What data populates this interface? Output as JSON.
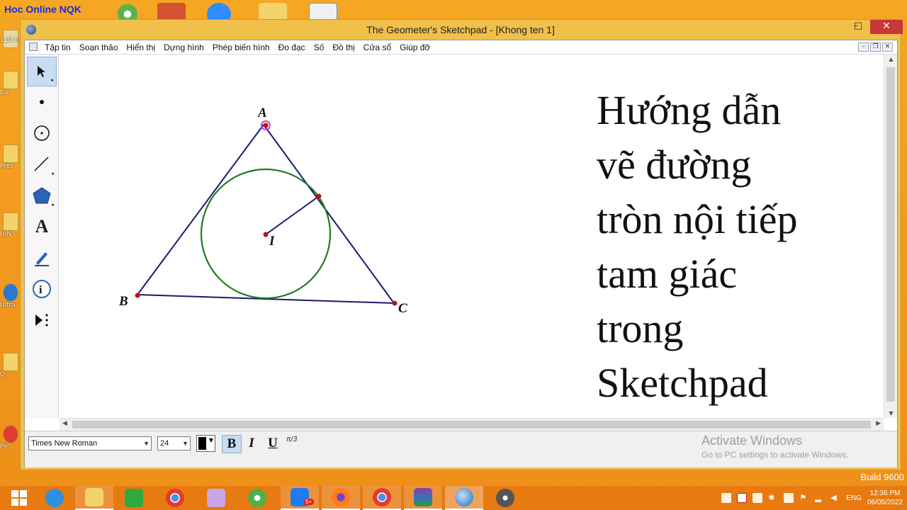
{
  "desktop": {
    "brand": "Hoc Online NQK",
    "top_icons": [
      "green-swirl-icon",
      "powerpoint-icon",
      "zoom-icon",
      "folder-icon",
      "document-icon"
    ],
    "left_items": [
      {
        "label": "110 b",
        "icon": "document-icon"
      },
      {
        "label": "ba",
        "icon": "folder-icon"
      },
      {
        "label": "Pres",
        "icon": "folder-icon"
      },
      {
        "label": "HIN",
        "icon": "folder-icon"
      },
      {
        "label": "Ultra",
        "icon": "shortcut-icon"
      },
      {
        "label": "Q",
        "icon": "folder-icon"
      },
      {
        "label": "Pe",
        "icon": "chrome-icon"
      }
    ],
    "activate_title": "Activate Windows",
    "activate_sub": "Go to PC settings to activate Windows.",
    "build": "Build 9600"
  },
  "window": {
    "title": "The Geometer's Sketchpad - [Khong ten 1]",
    "min": "–",
    "max": "□",
    "close": "✕"
  },
  "menu": {
    "items": [
      "Tập tin",
      "Soạn thảo",
      "Hiển thị",
      "Dựng hình",
      "Phép biến hình",
      "Đo đạc",
      "Số",
      "Đồ thị",
      "Cửa sổ",
      "Giúp đỡ"
    ],
    "mdi_min": "–",
    "mdi_restore": "❐",
    "mdi_close": "✕"
  },
  "tools": [
    {
      "name": "arrow-tool",
      "glyph": "➘",
      "active": true
    },
    {
      "name": "point-tool",
      "glyph": "•"
    },
    {
      "name": "compass-tool",
      "glyph": "⊕"
    },
    {
      "name": "straightedge-tool",
      "glyph": "╱"
    },
    {
      "name": "polygon-tool",
      "glyph": "⬟"
    },
    {
      "name": "text-tool",
      "glyph": "A"
    },
    {
      "name": "marker-tool",
      "glyph": "✎"
    },
    {
      "name": "information-tool",
      "glyph": "ⓘ"
    },
    {
      "name": "custom-tool",
      "glyph": "▶"
    }
  ],
  "figure": {
    "point_labels": {
      "A": "A",
      "B": "B",
      "C": "C",
      "I": "I"
    }
  },
  "title_text": {
    "lines": [
      "Hướng dẫn",
      "vẽ đường",
      "tròn nội tiếp",
      "tam giác",
      "trong",
      "Sketchpad"
    ]
  },
  "textbar": {
    "font": "Times New Roman",
    "size": "24",
    "bold": "B",
    "italic": "I",
    "underline": "U",
    "symbol": "π/3",
    "text_color": "#000000"
  },
  "taskbar": {
    "apps": [
      {
        "name": "start-button",
        "color": "#ffffff"
      },
      {
        "name": "internet-explorer-icon",
        "color": "#2f8fe0"
      },
      {
        "name": "file-explorer-icon",
        "color": "#f5d36b"
      },
      {
        "name": "store-icon",
        "color": "#2eaa3f"
      },
      {
        "name": "chrome-icon",
        "color": "#e23b2e"
      },
      {
        "name": "paint-icon",
        "color": "#c8a6e8"
      },
      {
        "name": "green-swirl-icon",
        "color": "#4fb04a"
      },
      {
        "name": "zalo-icon",
        "color": "#1e7cf2"
      },
      {
        "name": "firefox-icon",
        "color": "#ff7b1a"
      },
      {
        "name": "chrome-icon",
        "color": "#e23b2e"
      },
      {
        "name": "winrar-icon",
        "color": "#8a3fa0"
      },
      {
        "name": "sketchpad-icon",
        "color": "#4a8fd8"
      },
      {
        "name": "film-icon",
        "color": "#555555"
      }
    ],
    "zalo_badge": "5+",
    "lang": "ENG",
    "time": "12:36 PM",
    "date": "06/05/2022"
  }
}
